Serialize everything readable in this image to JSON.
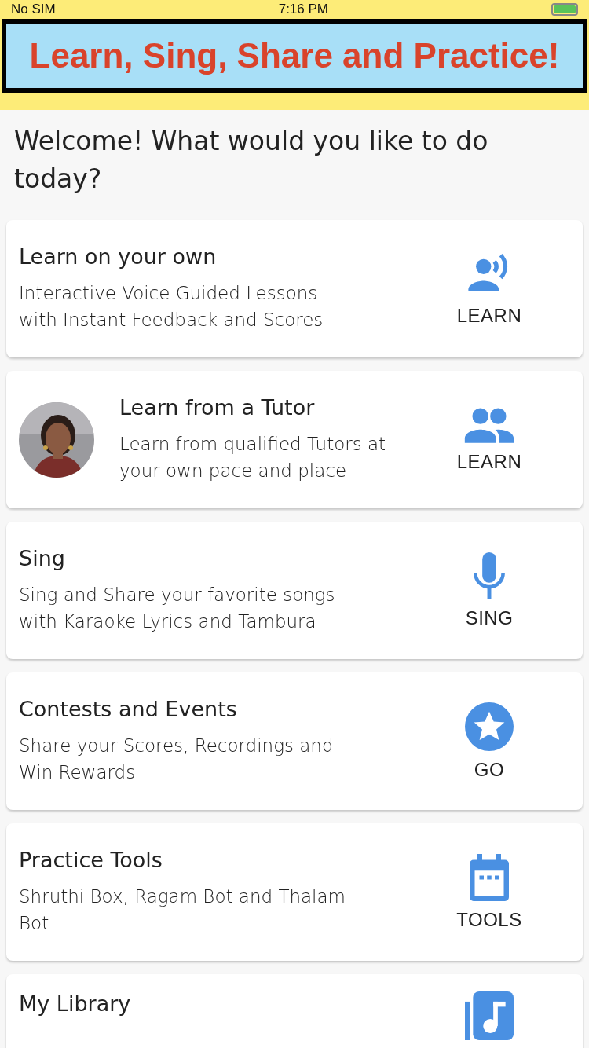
{
  "status_bar": {
    "carrier": "No SIM",
    "time": "7:16 PM"
  },
  "banner": {
    "title": "Learn, Sing, Share and Practice!"
  },
  "heading": "Welcome! What would you like to do today?",
  "cards": [
    {
      "title": "Learn on your own",
      "description": "Interactive Voice Guided Lessons with Instant Feedback and Scores",
      "action": "LEARN"
    },
    {
      "title": "Learn from a Tutor",
      "description": "Learn from qualified Tutors at your own pace and place",
      "action": "LEARN",
      "kind": "picture"
    },
    {
      "title": "Sing",
      "description": "Sing and Share your favorite songs with Karaoke Lyrics and Tambura",
      "action": "SING"
    },
    {
      "title": "Contests and Events",
      "description": "Share your Scores, Recordings and Win Rewards",
      "action": "GO"
    },
    {
      "title": "Practice Tools",
      "description": "Shruthi Box, Ragam Bot and Thalam Bot",
      "action": "TOOLS"
    },
    {
      "title": "My Library"
    }
  ]
}
